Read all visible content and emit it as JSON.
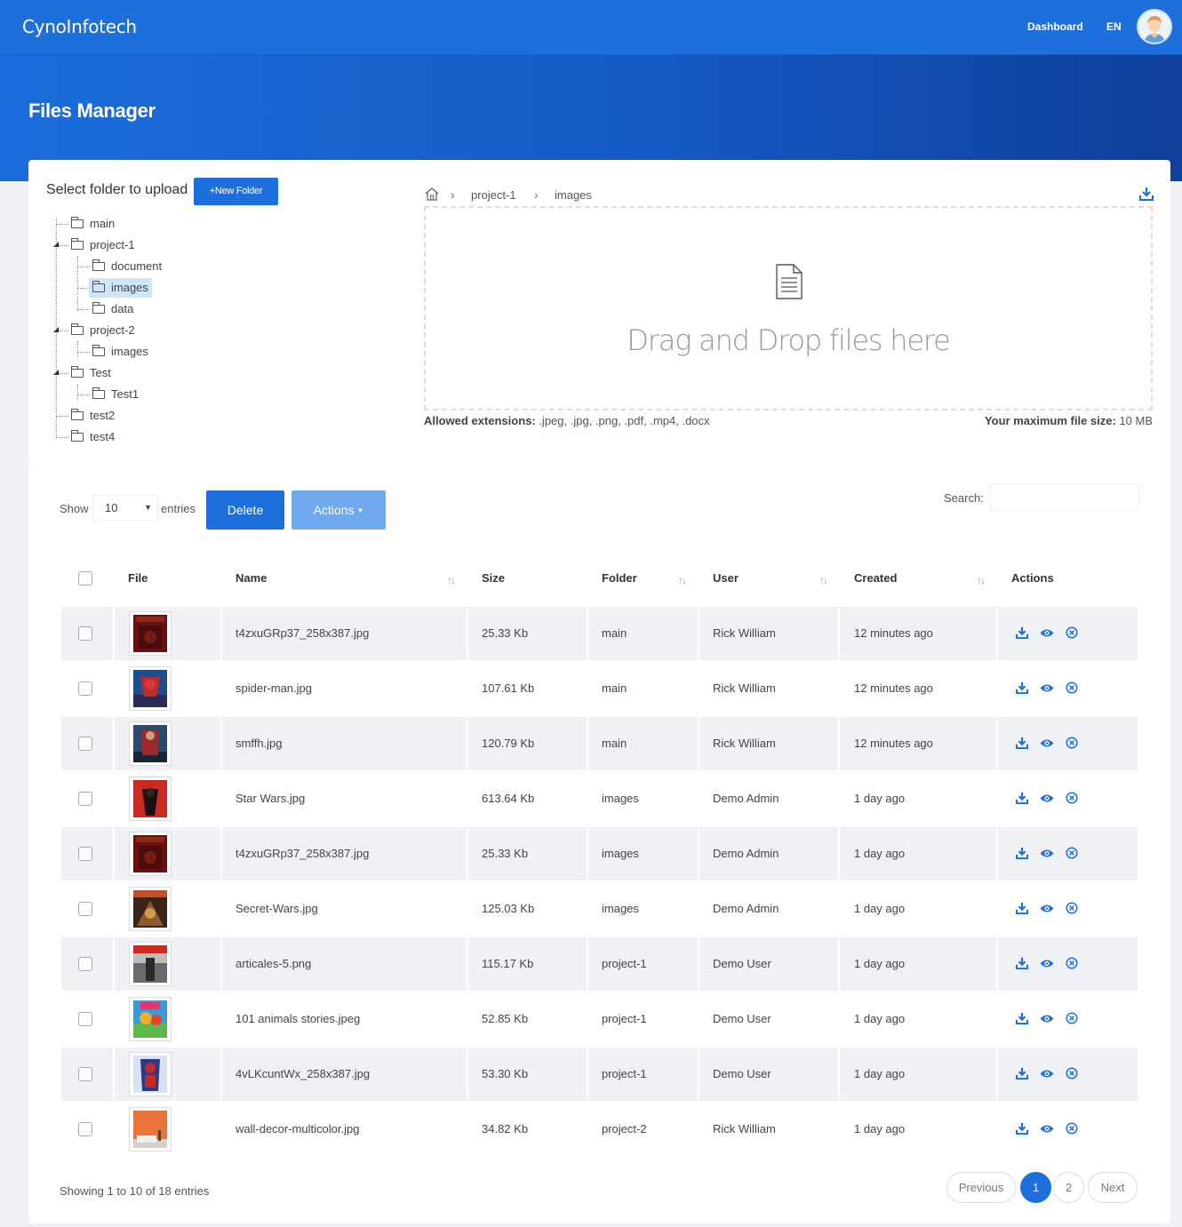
{
  "app": {
    "brand": "CynoInfotech",
    "nav_dashboard": "Dashboard",
    "nav_lang": "EN"
  },
  "page": {
    "title": "Files Manager"
  },
  "upload": {
    "select_label": "Select folder to upload",
    "new_folder_label": "+New Folder",
    "tree": [
      {
        "label": "main"
      },
      {
        "label": "project-1"
      },
      {
        "label": "document"
      },
      {
        "label": "images",
        "selected": true
      },
      {
        "label": "data"
      },
      {
        "label": "project-2"
      },
      {
        "label": "images"
      },
      {
        "label": "Test"
      },
      {
        "label": "Test1"
      },
      {
        "label": "test2"
      },
      {
        "label": "test4"
      }
    ],
    "breadcrumb": [
      "project-1",
      "images"
    ],
    "dropzone_text": "Drag and Drop files here",
    "allowed_label": "Allowed extensions:",
    "allowed_value": " .jpeg, .jpg, .png, .pdf, .mp4, .docx",
    "maxsize_label": "Your maximum file size:",
    "maxsize_value": " 10 MB"
  },
  "table_controls": {
    "show_label": "Show",
    "page_size": "10",
    "entries_label": "entries",
    "delete_label": "Delete",
    "actions_label": "Actions",
    "search_label": "Search:",
    "search_value": ""
  },
  "table": {
    "columns": [
      "File",
      "Name",
      "Size",
      "Folder",
      "User",
      "Created",
      "Actions"
    ],
    "rows": [
      {
        "name": "t4zxuGRp37_258x387.jpg",
        "size": "25.33 Kb",
        "folder": "main",
        "user": "Rick William",
        "created": "12 minutes ago",
        "thumb": "harry-potter-cover"
      },
      {
        "name": "spider-man.jpg",
        "size": "107.61 Kb",
        "folder": "main",
        "user": "Rick William",
        "created": "12 minutes ago",
        "thumb": "spider-man-cover"
      },
      {
        "name": "smffh.jpg",
        "size": "120.79 Kb",
        "folder": "main",
        "user": "Rick William",
        "created": "12 minutes ago",
        "thumb": "spider-man-poster"
      },
      {
        "name": "Star Wars.jpg",
        "size": "613.64 Kb",
        "folder": "images",
        "user": "Demo Admin",
        "created": "1 day ago",
        "thumb": "star-wars-cover"
      },
      {
        "name": "t4zxuGRp37_258x387.jpg",
        "size": "25.33 Kb",
        "folder": "images",
        "user": "Demo Admin",
        "created": "1 day ago",
        "thumb": "harry-potter-cover"
      },
      {
        "name": "Secret-Wars.jpg",
        "size": "125.03 Kb",
        "folder": "images",
        "user": "Demo Admin",
        "created": "1 day ago",
        "thumb": "secret-wars-cover"
      },
      {
        "name": "articales-5.png",
        "size": "115.17 Kb",
        "folder": "project-1",
        "user": "Demo User",
        "created": "1 day ago",
        "thumb": "article-5-cover"
      },
      {
        "name": "101 animals stories.jpeg",
        "size": "52.85 Kb",
        "folder": "project-1",
        "user": "Demo User",
        "created": "1 day ago",
        "thumb": "animals-stories-cover"
      },
      {
        "name": "4vLKcuntWx_258x387.jpg",
        "size": "53.30 Kb",
        "folder": "project-1",
        "user": "Demo User",
        "created": "1 day ago",
        "thumb": "comic-cover"
      },
      {
        "name": "wall-decor-multicolor.jpg",
        "size": "34.82 Kb",
        "folder": "project-2",
        "user": "Rick William",
        "created": "1 day ago",
        "thumb": "wall-decor-photo"
      }
    ]
  },
  "pager": {
    "info": "Showing 1 to 10 of 18 entries",
    "previous": "Previous",
    "pages": [
      "1",
      "2"
    ],
    "current": "1",
    "next": "Next"
  },
  "colors": {
    "primary": "#1d6fdb",
    "actions_button": "#70a8ee",
    "row_shade": "#eff1f4"
  }
}
